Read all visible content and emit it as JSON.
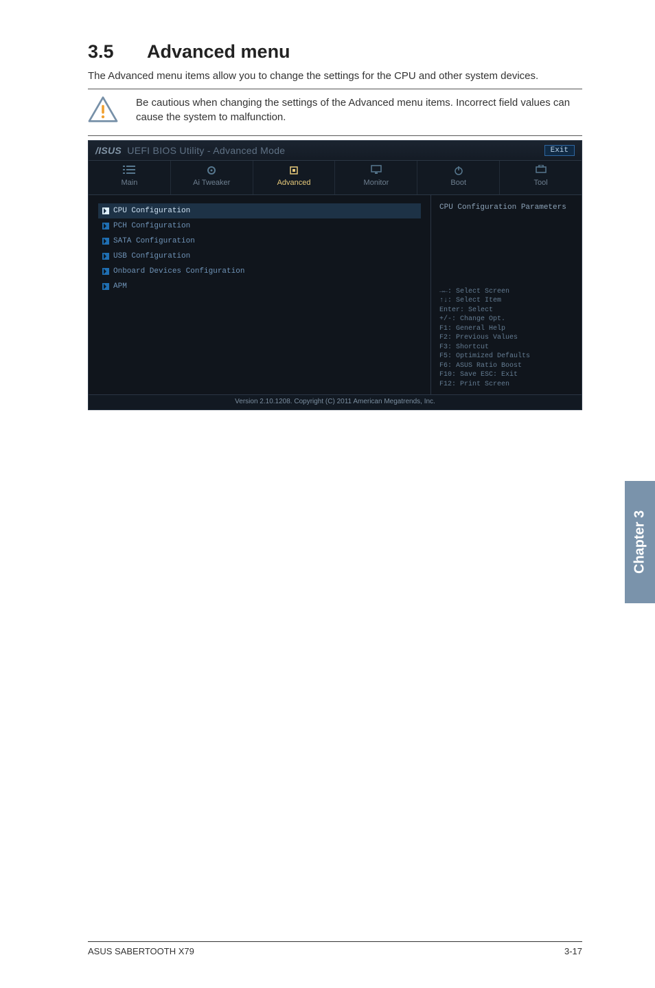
{
  "section": {
    "number": "3.5",
    "title": "Advanced menu"
  },
  "intro": "The Advanced menu items allow you to change the settings for the CPU and other system devices.",
  "callout": "Be cautious when changing the settings of the Advanced menu items. Incorrect field values can cause the system to malfunction.",
  "bios": {
    "brand": "/ISUS",
    "title": "UEFI BIOS Utility - Advanced Mode",
    "exit": "Exit",
    "tabs": [
      {
        "label": "Main"
      },
      {
        "label": "Ai Tweaker"
      },
      {
        "label": "Advanced"
      },
      {
        "label": "Monitor"
      },
      {
        "label": "Boot"
      },
      {
        "label": "Tool"
      }
    ],
    "active_tab": 2,
    "menu": [
      {
        "label": "CPU Configuration",
        "selected": true
      },
      {
        "label": "PCH Configuration"
      },
      {
        "label": "SATA Configuration"
      },
      {
        "label": "USB Configuration"
      },
      {
        "label": "Onboard Devices Configuration"
      },
      {
        "label": "APM"
      }
    ],
    "right_heading": "CPU Configuration Parameters",
    "help_lines": [
      "→←: Select Screen",
      "↑↓: Select Item",
      "Enter: Select",
      "+/-: Change Opt.",
      "F1: General Help",
      "F2: Previous Values",
      "F3: Shortcut",
      "F5: Optimized Defaults",
      "F6: ASUS Ratio Boost",
      "F10: Save  ESC: Exit",
      "F12: Print Screen"
    ],
    "footer": "Version 2.10.1208. Copyright (C) 2011 American Megatrends, Inc."
  },
  "chapter_tab": "Chapter 3",
  "footer": {
    "left": "ASUS SABERTOOTH X79",
    "right": "3-17"
  }
}
